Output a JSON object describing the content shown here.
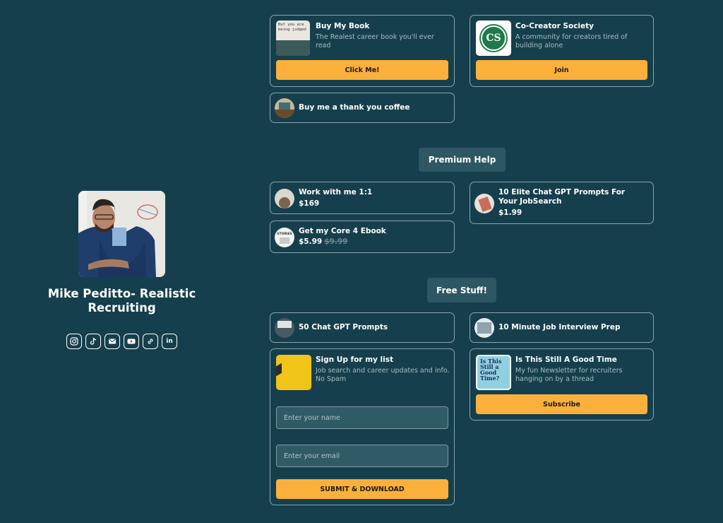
{
  "profile": {
    "name": "Mike Peditto- Realistic Recruiting",
    "socials": [
      "instagram-icon",
      "tiktok-icon",
      "mail-icon",
      "youtube-icon",
      "link-icon",
      "linkedin-icon"
    ],
    "linkedin_text": "in"
  },
  "top": {
    "book": {
      "title": "Buy My Book",
      "desc": "The Realest career book you'll ever read",
      "thumb_text": [
        "But you are",
        "being judged"
      ],
      "button": "Click Me!"
    },
    "society": {
      "title": "Co-Creator Society",
      "desc": "A community for creators tired of building alone",
      "logo_text": "CS",
      "button": "Join"
    },
    "coffee": {
      "title": "Buy me a thank you coffee"
    }
  },
  "premium": {
    "label": "Premium Help",
    "work": {
      "title": "Work with me 1:1",
      "price": "$169"
    },
    "prompts": {
      "title": "10 Elite Chat GPT Prompts For Your JobSearch",
      "price": "$1.99"
    },
    "ebook": {
      "title": "Get my Core 4 Ebook",
      "price": "$5.99",
      "old_price": "$9.99",
      "thumb_text": "STORIES"
    }
  },
  "free": {
    "label": "Free Stuff!",
    "chatgpt": {
      "title": "50 Chat GPT Prompts"
    },
    "interview": {
      "title": "10 Minute Job Interview Prep"
    },
    "signup": {
      "title": "Sign Up for my list",
      "desc": "Job search and career updates and info. No Spam",
      "name_placeholder": "Enter your name",
      "email_placeholder": "Enter your email",
      "button": "SUBMIT & DOWNLOAD"
    },
    "newsletter": {
      "title": "Is This Still A Good Time",
      "desc": "My fun Newsletter for recruiters hanging on by a thread",
      "thumb_text": [
        "Is This",
        "Still a",
        "Good",
        "Time?"
      ],
      "button": "Subscribe"
    }
  },
  "colors": {
    "background": "#163f4d",
    "accent": "#fbb03b",
    "border": "#8aa4ae",
    "chip": "#2d5763"
  }
}
